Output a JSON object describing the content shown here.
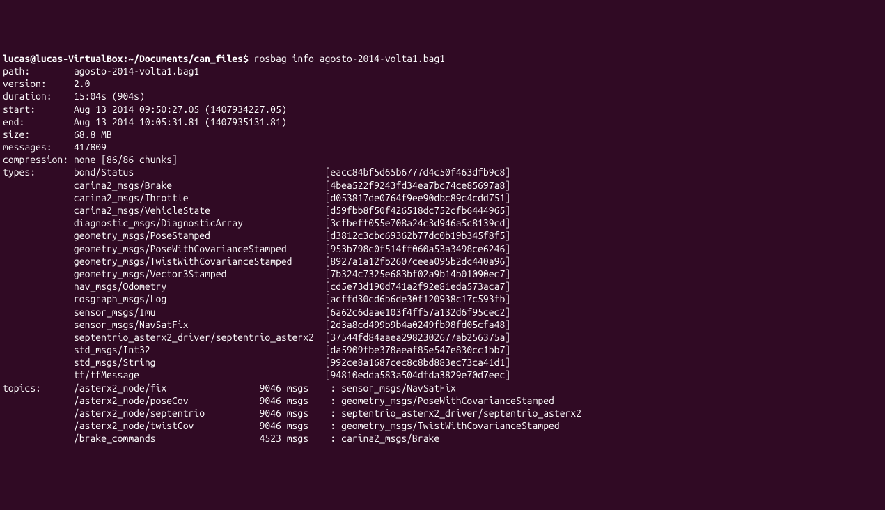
{
  "prompt": {
    "user_host": "lucas@lucas-VirtualBox",
    "path": "~/Documents/can_files",
    "command": "rosbag info agosto-2014-volta1.bag1"
  },
  "info": {
    "path": "agosto-2014-volta1.bag1",
    "version": "2.0",
    "duration": "15:04s (904s)",
    "start": "Aug 13 2014 09:50:27.05 (1407934227.05)",
    "end": "Aug 13 2014 10:05:31.81 (1407935131.81)",
    "size": "68.8 MB",
    "messages": "417809",
    "compression": "none [86/86 chunks]"
  },
  "types": [
    {
      "name": "bond/Status",
      "hash": "[eacc84bf5d65b6777d4c50f463dfb9c8]"
    },
    {
      "name": "carina2_msgs/Brake",
      "hash": "[4bea522f9243fd34ea7bc74ce85697a8]"
    },
    {
      "name": "carina2_msgs/Throttle",
      "hash": "[d053817de0764f9ee90dbc89c4cdd751]"
    },
    {
      "name": "carina2_msgs/VehicleState",
      "hash": "[d59fbb8f50f426518dc752cfb6444965]"
    },
    {
      "name": "diagnostic_msgs/DiagnosticArray",
      "hash": "[3cfbeff055e708a24c3d946a5c8139cd]"
    },
    {
      "name": "geometry_msgs/PoseStamped",
      "hash": "[d3812c3cbc69362b77dc0b19b345f8f5]"
    },
    {
      "name": "geometry_msgs/PoseWithCovarianceStamped",
      "hash": "[953b798c0f514ff060a53a3498ce6246]"
    },
    {
      "name": "geometry_msgs/TwistWithCovarianceStamped",
      "hash": "[8927a1a12fb2607ceea095b2dc440a96]"
    },
    {
      "name": "geometry_msgs/Vector3Stamped",
      "hash": "[7b324c7325e683bf02a9b14b01090ec7]"
    },
    {
      "name": "nav_msgs/Odometry",
      "hash": "[cd5e73d190d741a2f92e81eda573aca7]"
    },
    {
      "name": "rosgraph_msgs/Log",
      "hash": "[acffd30cd6b6de30f120938c17c593fb]"
    },
    {
      "name": "sensor_msgs/Imu",
      "hash": "[6a62c6daae103f4ff57a132d6f95cec2]"
    },
    {
      "name": "sensor_msgs/NavSatFix",
      "hash": "[2d3a8cd499b9b4a0249fb98fd05cfa48]"
    },
    {
      "name": "septentrio_asterx2_driver/septentrio_asterx2",
      "hash": "[37544fd84aaea2982302677ab256375a]"
    },
    {
      "name": "std_msgs/Int32",
      "hash": "[da5909fbe378aeaf85e547e830cc1bb7]"
    },
    {
      "name": "std_msgs/String",
      "hash": "[992ce8a1687cec8c8bd883ec73ca41d1]"
    },
    {
      "name": "tf/tfMessage",
      "hash": "[94810edda583a504dfda3829e70d7eec]"
    }
  ],
  "topics": [
    {
      "topic": "/asterx2_node/fix",
      "count": "9046",
      "type": "sensor_msgs/NavSatFix"
    },
    {
      "topic": "/asterx2_node/poseCov",
      "count": "9046",
      "type": "geometry_msgs/PoseWithCovarianceStamped"
    },
    {
      "topic": "/asterx2_node/septentrio",
      "count": "9046",
      "type": "septentrio_asterx2_driver/septentrio_asterx2"
    },
    {
      "topic": "/asterx2_node/twistCov",
      "count": "9046",
      "type": "geometry_msgs/TwistWithCovarianceStamped"
    },
    {
      "topic": "/brake_commands",
      "count": "4523",
      "type": "carina2_msgs/Brake"
    }
  ],
  "labels": {
    "path": "path:",
    "version": "version:",
    "duration": "duration:",
    "start": "start:",
    "end": "end:",
    "size": "size:",
    "messages": "messages:",
    "compression": "compression:",
    "types": "types:",
    "topics": "topics:",
    "msgs": "msgs",
    "colon": ":"
  }
}
